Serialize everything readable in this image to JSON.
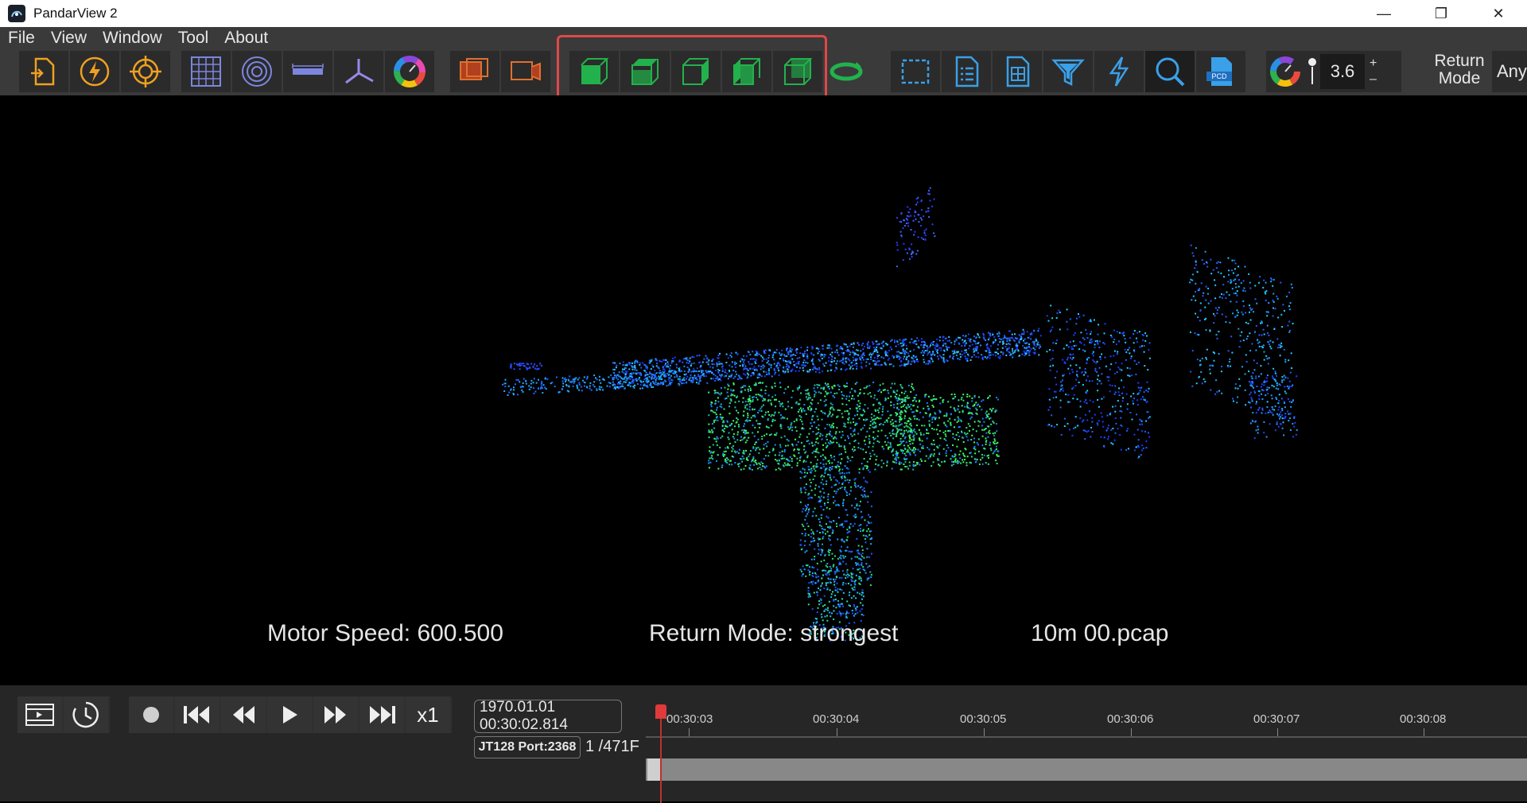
{
  "window": {
    "title": "PandarView 2",
    "controls": [
      "—",
      "❐",
      "✕"
    ]
  },
  "menu": [
    "File",
    "View",
    "Window",
    "Tool",
    "About"
  ],
  "toolbar": {
    "point_size": "3.6",
    "plus": "+",
    "minus": "–",
    "return_mode_label": "Return Mode",
    "return_mode_value": "Any",
    "pcd_label": "PCD"
  },
  "overlay": {
    "motor_speed": "Motor Speed:   600.500",
    "return_mode": "Return Mode: strongest",
    "file_name": "10m 00.pcap"
  },
  "playback": {
    "speed": "x1",
    "timestamp": "1970.01.01 00:30:02.814",
    "port": "JT128 Port:2368",
    "frame": "1 /471F",
    "ticks": [
      "00:30:03",
      "00:30:04",
      "00:30:05",
      "00:30:06",
      "00:30:07",
      "00:30:08"
    ]
  },
  "colors": {
    "accent_orange": "#f0a020",
    "cube_green": "#22b24c",
    "icon_blue": "#3aa0e8",
    "highlight": "#e04848"
  }
}
